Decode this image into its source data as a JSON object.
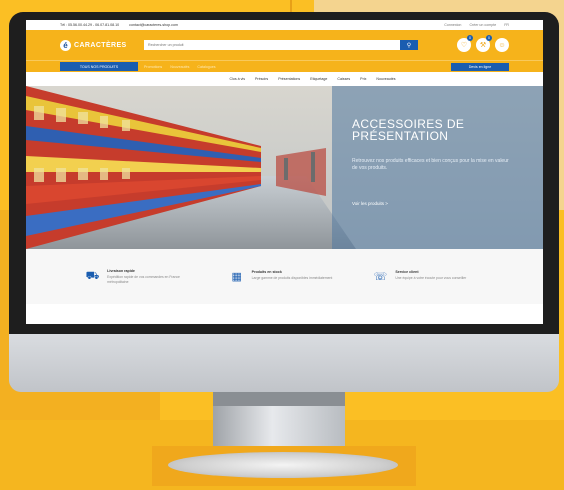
{
  "colors": {
    "page_bg": "#fbbf24",
    "site_primary": "#f6b31b",
    "site_blue": "#1a5db0",
    "bezel": "#1e1e1e"
  },
  "topbar": {
    "phone": "Tél : 05.56.00.44.29 - 06.07.81.08.10",
    "email": "contact@caracteres-shop.com",
    "right_links": [
      "Connexion",
      "Créer un compte",
      "FR"
    ]
  },
  "header": {
    "logo_letter": "é",
    "logo_text": "CARACTÈRES",
    "search_placeholder": "Rechercher un produit",
    "search_icon": "search-icon",
    "icons": [
      {
        "name": "heart-icon",
        "badge": "0"
      },
      {
        "name": "cart-icon",
        "badge": "0"
      },
      {
        "name": "user-icon",
        "badge": ""
      }
    ]
  },
  "nav": {
    "categories_button": "TOUS NOS PRODUITS",
    "links": [
      "Promotions",
      "Nouveautés",
      "Catalogues"
    ],
    "quote_button": "Devis en ligne"
  },
  "menu": {
    "items": [
      "Clos à vis",
      "Présoirs",
      "Présentations",
      "Etiquetage",
      "Caisses",
      "Prix",
      "Nouveautés"
    ]
  },
  "hero": {
    "title": "ACCESSOIRES DE PRÉSENTATION",
    "text": "Retrouvez nos produits efficaces et bien conçus pour la mise en valeur de vos produits.",
    "link": "Voir les produits >"
  },
  "features": [
    {
      "icon": "truck-icon",
      "title": "Livraison rapide",
      "desc": "Expédition rapide de vos commandes en France métropolitaine"
    },
    {
      "icon": "stock-icon",
      "title": "Produits en stock",
      "desc": "Large gamme de produits disponibles immédiatement"
    },
    {
      "icon": "service-icon",
      "title": "Service client",
      "desc": "Une équipe à votre écoute pour vous conseiller"
    }
  ]
}
